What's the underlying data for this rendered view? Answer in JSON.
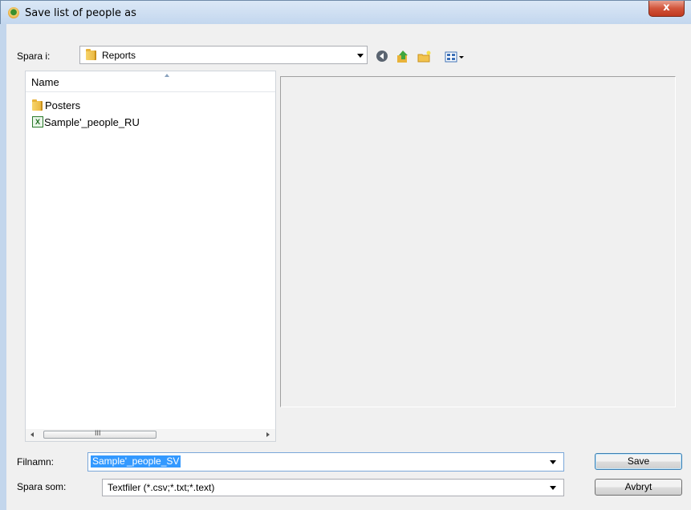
{
  "window": {
    "title": "Save list of people as",
    "close_label": "x"
  },
  "save_in": {
    "label": "Spara i:",
    "value": "Reports"
  },
  "toolbar": {
    "icons": [
      "back-icon",
      "up-folder-icon",
      "new-folder-icon",
      "view-menu-icon"
    ]
  },
  "file_list": {
    "column_header": "Name",
    "items": [
      {
        "label": "Posters",
        "icon": "folder-icon"
      },
      {
        "label": "Sample'_people_RU",
        "icon": "excel-file-icon"
      }
    ],
    "scroll_grip": "III"
  },
  "filename": {
    "label": "Filnamn:",
    "value": "Sample'_people_SV"
  },
  "save_as_type": {
    "label": "Spara som:",
    "value": "Textfiler (*.csv;*.txt;*.text)"
  },
  "buttons": {
    "save": "Save",
    "cancel": "Avbryt"
  }
}
